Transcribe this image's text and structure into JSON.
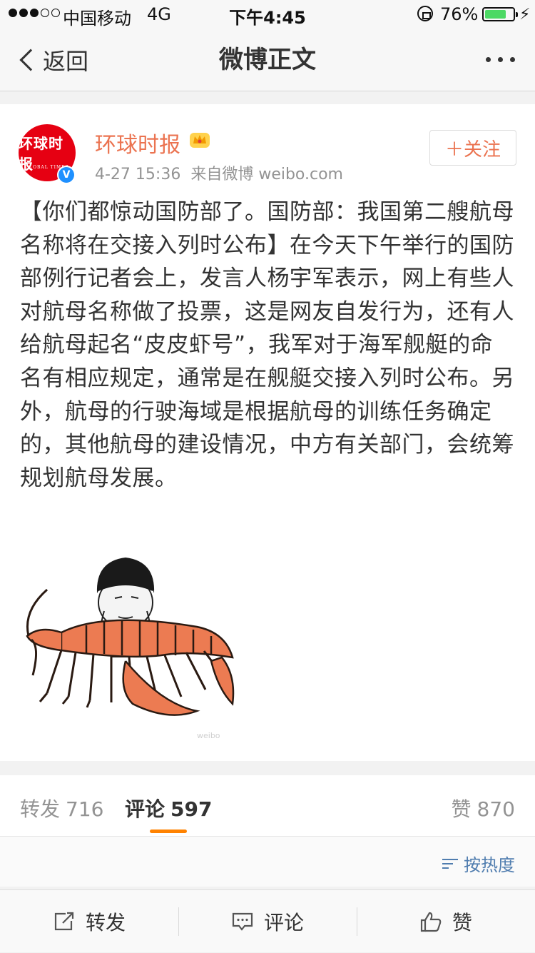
{
  "status_bar": {
    "carrier": "中国移动",
    "network": "4G",
    "time": "下午4:45",
    "battery_percent": "76%",
    "battery_level": 0.76,
    "signal_bars_filled": 3,
    "signal_bars_total": 5
  },
  "nav": {
    "back_label": "返回",
    "title": "微博正文",
    "more_icon": "ellipsis-icon"
  },
  "post": {
    "author": "环球时报",
    "avatar_text": "环球时报",
    "avatar_subtext": "GLOBAL TIMES",
    "verified_icon": "verified-v-icon",
    "vip_icon": "crown-icon",
    "time": "4-27 15:36",
    "source": "来自微博 weibo.com",
    "follow_label": "＋关注",
    "text": "【你们都惊动国防部了。国防部：我国第二艘航母名称将在交接入列时公布】在今天下午举行的国防部例行记者会上，发言人杨宇军表示，网上有些人对航母名称做了投票，这是网友自发行为，还有人给航母起名“皮皮虾号”，我军对于海军舰艇的命名有相应规定，通常是在舰艇交接入列时公布。另外，航母的行驶海域是根据航母的训练任务确定的，其他航母的建设情况，中方有关部门，会统筹规划航母发展。"
  },
  "tabs": {
    "repost_label": "转发",
    "repost_count": "716",
    "comment_label": "评论",
    "comment_count": "597",
    "like_label": "赞",
    "like_count": "870"
  },
  "sort": {
    "label": "按热度"
  },
  "toolbar": {
    "repost_label": "转发",
    "comment_label": "评论",
    "like_label": "赞"
  },
  "colors": {
    "accent_orange": "#eb7350",
    "tab_underline": "#ff8200",
    "link_blue": "#507daf",
    "avatar_red": "#e60012"
  }
}
